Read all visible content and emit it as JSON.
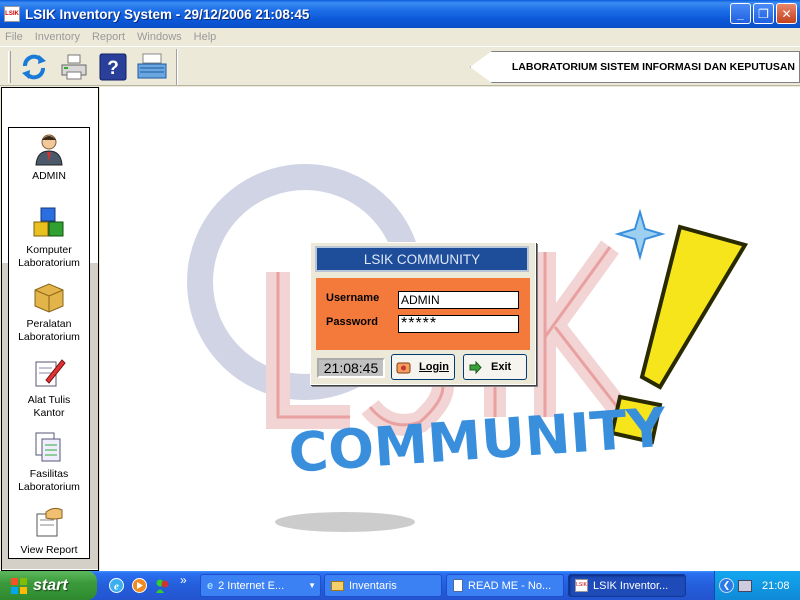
{
  "window": {
    "title": "LSIK Inventory System - 29/12/2006 21:08:45",
    "app_icon": "LSIK",
    "minimize": "_",
    "maximize": "❐",
    "close": "✕"
  },
  "menu": {
    "items": [
      "File",
      "Inventory",
      "Report",
      "Windows",
      "Help"
    ],
    "enabled": false
  },
  "toolbar": {
    "buttons": [
      "refresh-icon",
      "printer-icon",
      "help-icon",
      "scanner-icon"
    ],
    "banner": "LABORATORIUM SISTEM INFORMASI DAN KEPUTUSAN"
  },
  "sidebar": {
    "items": [
      {
        "label": "ADMIN",
        "icon": "admin-user-icon"
      },
      {
        "label": "Komputer\nLaboratorium",
        "icon": "cubes-icon"
      },
      {
        "label": "Peralatan\nLaboratorium",
        "icon": "boxes-icon"
      },
      {
        "label": "Alat Tulis\nKantor",
        "icon": "pen-paper-icon"
      },
      {
        "label": "Fasilitas\nLaboratorium",
        "icon": "documents-icon"
      },
      {
        "label": "View Report",
        "icon": "report-hand-icon"
      }
    ]
  },
  "background_logo": {
    "text": "LSIK",
    "subtext": "COMMUNITY",
    "colors": {
      "ring": "#b0b7d0",
      "letters": "#e8a0a0",
      "community": "#3a8fdd",
      "exclaim": "#f5e51a"
    }
  },
  "login": {
    "header": "LSIK COMMUNITY",
    "username_label": "Username",
    "password_label": "Password",
    "username_value": "ADMIN",
    "password_value": "*****",
    "clock": "21:08:45",
    "login_button": "Login",
    "exit_button": "Exit",
    "colors": {
      "header_bg": "#1e4d9a",
      "body_bg": "#f47a3c"
    }
  },
  "taskbar": {
    "start_label": "start",
    "quick_launch": [
      "ie-icon",
      "media-player-icon",
      "messenger-icon"
    ],
    "overflow": "»",
    "tasks": [
      {
        "label": "2 Internet E...",
        "icon": "ie-icon",
        "active": false
      },
      {
        "label": "Inventaris",
        "icon": "folder-icon",
        "active": false
      },
      {
        "label": "READ ME - No...",
        "icon": "notepad-icon",
        "active": false
      },
      {
        "label": "LSIK Inventor...",
        "icon": "app-icon",
        "active": true
      }
    ],
    "clock": "21:08"
  }
}
